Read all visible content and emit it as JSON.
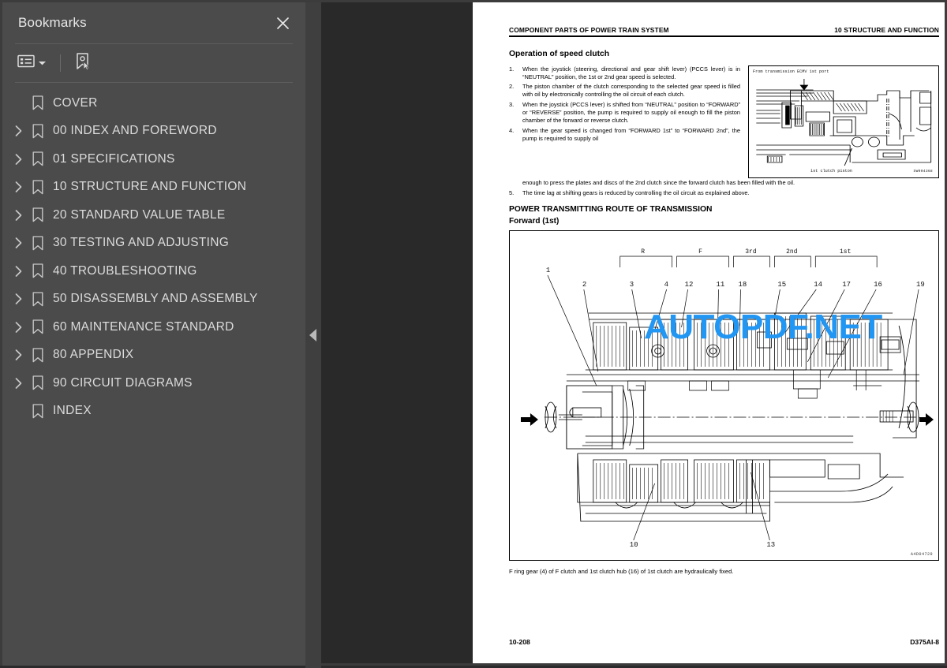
{
  "sidebar": {
    "title": "Bookmarks",
    "close_label": "×",
    "toolbar": {
      "options_label": "Bookmark options",
      "dropdown_label": "▾",
      "new_bookmark_label": "New bookmark"
    },
    "items": [
      {
        "label": "COVER",
        "expandable": false
      },
      {
        "label": "00 INDEX AND FOREWORD",
        "expandable": true
      },
      {
        "label": "01 SPECIFICATIONS",
        "expandable": true
      },
      {
        "label": "10 STRUCTURE AND FUNCTION",
        "expandable": true
      },
      {
        "label": "20 STANDARD VALUE TABLE",
        "expandable": true
      },
      {
        "label": "30 TESTING AND ADJUSTING",
        "expandable": true
      },
      {
        "label": "40 TROUBLESHOOTING",
        "expandable": true
      },
      {
        "label": "50 DISASSEMBLY AND ASSEMBLY",
        "expandable": true
      },
      {
        "label": "60 MAINTENANCE STANDARD",
        "expandable": true
      },
      {
        "label": "80 APPENDIX",
        "expandable": true
      },
      {
        "label": "90 CIRCUIT DIAGRAMS",
        "expandable": true
      },
      {
        "label": "INDEX",
        "expandable": false
      }
    ]
  },
  "splitter": {
    "collapse_label": "◀"
  },
  "watermark": {
    "text": "AUTOPDF.NET",
    "color": "#2196f3"
  },
  "document": {
    "header_left": "COMPONENT PARTS OF POWER TRAIN SYSTEM",
    "header_right": "10 STRUCTURE AND FUNCTION",
    "section_title": "Operation of speed clutch",
    "steps": [
      {
        "num": "1.",
        "text": "When the joystick (steering, directional and gear shift lever) (PCCS lever) is in “NEUTRAL” position, the 1st or 2nd gear speed is selected."
      },
      {
        "num": "2.",
        "text": "The piston chamber of the clutch corresponding to the selected gear speed is filled with oil by electronically controlling the oil circuit of each clutch."
      },
      {
        "num": "3.",
        "text": "When the joystick (PCCS lever) is shifted from “NEUTRAL” position to “FORWARD” or “REVERSE” position, the pump is required to supply oil enough to fill the piston chamber of the forward or reverse clutch."
      },
      {
        "num": "4.",
        "text": "When the gear speed is changed from “FORWARD 1st” to “FORWARD 2nd”, the pump is required to supply oil"
      }
    ],
    "step4_continued": "enough to press the plates and discs of the 2nd clutch since the forward clutch has been filled with the oil.",
    "step5": {
      "num": "5.",
      "text": "The time lag at shifting gears is reduced by controlling the oil circuit as explained above."
    },
    "heading2": "POWER TRANSMITTING ROUTE OF TRANSMISSION",
    "heading3": "Forward (1st)",
    "caption": "F ring gear (4) of F clutch and 1st clutch hub (16) of 1st clutch are hydraulically fixed.",
    "footer_left": "10-208",
    "footer_right": "D375AI-8",
    "mini_figure": {
      "top_label": "From transmission ECMV 1st port",
      "bottom_label": "1st clutch piston",
      "figure_id": "SW004368"
    },
    "big_figure": {
      "figure_id": "A4D04729",
      "group_labels": [
        "R",
        "F",
        "3rd",
        "2nd",
        "1st"
      ],
      "callouts_top": [
        "2",
        "3",
        "4",
        "12",
        "11",
        "18",
        "15",
        "14",
        "17",
        "16",
        "19"
      ],
      "callout_left": "1",
      "callouts_bottom": [
        "10",
        "13"
      ]
    }
  }
}
